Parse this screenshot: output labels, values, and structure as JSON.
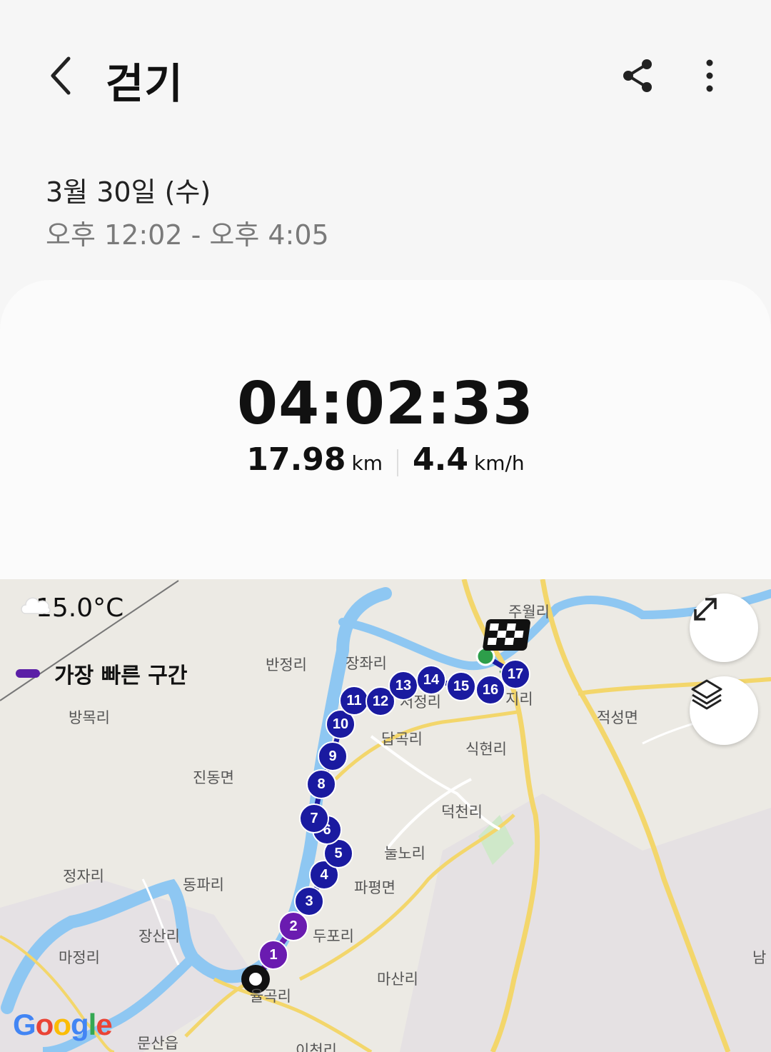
{
  "header": {
    "title": "걷기"
  },
  "session": {
    "date": "3월 30일 (수)",
    "time_range": "오후 12:02 - 오후 4:05"
  },
  "summary": {
    "duration": "04:02:33",
    "distance_value": "17.98",
    "distance_unit": "km",
    "speed_value": "4.4",
    "speed_unit": "km/h"
  },
  "map": {
    "temperature": "15.0°C",
    "legend_label": "가장 빠른 구간",
    "place_labels": [
      "주월리",
      "반정리",
      "장좌리",
      "적성면",
      "방목리",
      "답곡리",
      "식현리",
      "진동면",
      "덕천리",
      "눌노리",
      "정자리",
      "동파리",
      "파평면",
      "두포리",
      "장산리",
      "마정리",
      "마산리",
      "율곡리",
      "문산읍",
      "이천리",
      "남",
      "지리",
      "저정리"
    ],
    "markers": [
      "1",
      "2",
      "3",
      "4",
      "5",
      "6",
      "7",
      "8",
      "9",
      "10",
      "11",
      "12",
      "13",
      "14",
      "15",
      "16",
      "17"
    ],
    "route_color": "#1a1aa0",
    "fastest_color": "#6a1bb0",
    "google_text": "Google"
  }
}
